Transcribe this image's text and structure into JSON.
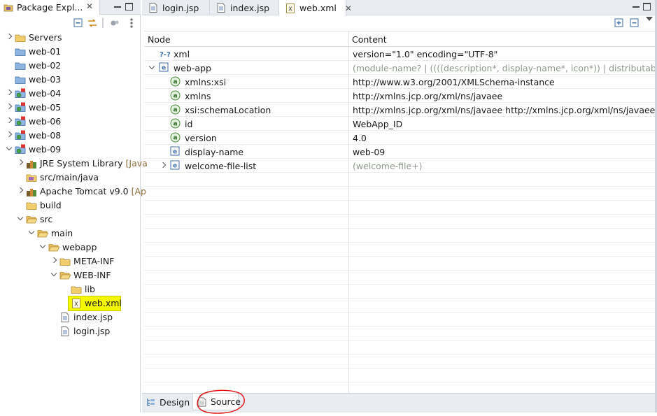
{
  "package_explorer": {
    "tab_label": "Package Expl...",
    "tree": [
      {
        "label": "Servers",
        "icon": "folder-icon",
        "depth": 0,
        "twisty": "right"
      },
      {
        "label": "web-01",
        "icon": "project-folder-icon",
        "depth": 0,
        "twisty": "none"
      },
      {
        "label": "web-02",
        "icon": "project-folder-icon",
        "depth": 0,
        "twisty": "none"
      },
      {
        "label": "web-03",
        "icon": "project-folder-icon",
        "depth": 0,
        "twisty": "none"
      },
      {
        "label": "web-04",
        "icon": "web-project-icon",
        "depth": 0,
        "twisty": "right"
      },
      {
        "label": "web-05",
        "icon": "web-project-icon",
        "depth": 0,
        "twisty": "right"
      },
      {
        "label": "web-06",
        "icon": "web-project-icon",
        "depth": 0,
        "twisty": "right"
      },
      {
        "label": "web-08",
        "icon": "web-project-icon",
        "depth": 0,
        "twisty": "right"
      },
      {
        "label": "web-09",
        "icon": "web-project-icon",
        "depth": 0,
        "twisty": "down"
      },
      {
        "label": "JRE System Library",
        "deco": "[Java",
        "icon": "library-icon",
        "depth": 1,
        "twisty": "right"
      },
      {
        "label": "src/main/java",
        "icon": "source-folder-icon",
        "depth": 1,
        "twisty": "none"
      },
      {
        "label": "Apache Tomcat v9.0",
        "deco": "[Ap",
        "icon": "library-icon",
        "depth": 1,
        "twisty": "right"
      },
      {
        "label": "build",
        "icon": "folder-icon",
        "depth": 1,
        "twisty": "none"
      },
      {
        "label": "src",
        "icon": "folder-open-icon",
        "depth": 1,
        "twisty": "down"
      },
      {
        "label": "main",
        "icon": "folder-open-icon",
        "depth": 2,
        "twisty": "down"
      },
      {
        "label": "webapp",
        "icon": "folder-open-icon",
        "depth": 3,
        "twisty": "down"
      },
      {
        "label": "META-INF",
        "icon": "folder-icon",
        "depth": 4,
        "twisty": "right"
      },
      {
        "label": "WEB-INF",
        "icon": "folder-open-icon",
        "depth": 4,
        "twisty": "down"
      },
      {
        "label": "lib",
        "icon": "folder-icon",
        "depth": 5,
        "twisty": "none"
      },
      {
        "label": "web.xml",
        "icon": "xml-file-icon",
        "depth": 5,
        "twisty": "none",
        "highlight": true
      },
      {
        "label": "index.jsp",
        "icon": "jsp-file-icon",
        "depth": 4,
        "twisty": "none"
      },
      {
        "label": "login.jsp",
        "icon": "jsp-file-icon",
        "depth": 4,
        "twisty": "none"
      }
    ]
  },
  "editor": {
    "tabs": [
      {
        "label": "login.jsp",
        "icon": "jsp-file-icon"
      },
      {
        "label": "index.jsp",
        "icon": "jsp-file-icon"
      },
      {
        "label": "web.xml",
        "icon": "xml-file-icon",
        "active": true
      }
    ],
    "grid": {
      "headers": {
        "node": "Node",
        "content": "Content"
      },
      "rows": [
        {
          "node": "xml",
          "icon": "processing-instruction-icon",
          "depth": 0,
          "twisty": "none",
          "content": "version=\"1.0\" encoding=\"UTF-8\"",
          "muted": false
        },
        {
          "node": "web-app",
          "icon": "element-icon",
          "depth": 0,
          "twisty": "down",
          "content": "(module-name? | ((((description*, display-name*, icon*)) | distributable | ...",
          "muted": true
        },
        {
          "node": "xmlns:xsi",
          "icon": "attribute-icon",
          "depth": 1,
          "twisty": "none",
          "content": "http://www.w3.org/2001/XMLSchema-instance",
          "muted": false
        },
        {
          "node": "xmlns",
          "icon": "attribute-icon",
          "depth": 1,
          "twisty": "none",
          "content": "http://xmlns.jcp.org/xml/ns/javaee",
          "muted": false
        },
        {
          "node": "xsi:schemaLocation",
          "icon": "attribute-icon",
          "depth": 1,
          "twisty": "none",
          "content": "http://xmlns.jcp.org/xml/ns/javaee http://xmlns.jcp.org/xml/ns/javaee/we...",
          "muted": false
        },
        {
          "node": "id",
          "icon": "attribute-icon",
          "depth": 1,
          "twisty": "none",
          "content": "WebApp_ID",
          "muted": false
        },
        {
          "node": "version",
          "icon": "attribute-icon",
          "depth": 1,
          "twisty": "none",
          "content": "4.0",
          "muted": false
        },
        {
          "node": "display-name",
          "icon": "element-icon",
          "depth": 1,
          "twisty": "none",
          "content": "web-09",
          "muted": false
        },
        {
          "node": "welcome-file-list",
          "icon": "element-icon",
          "depth": 1,
          "twisty": "right",
          "content": "(welcome-file+)",
          "muted": true
        }
      ],
      "empty_rows": 15
    },
    "bottom_tabs": [
      {
        "label": "Design",
        "icon": "design-view-icon"
      },
      {
        "label": "Source",
        "icon": "source-view-icon",
        "active": true,
        "annotated": true
      }
    ]
  }
}
